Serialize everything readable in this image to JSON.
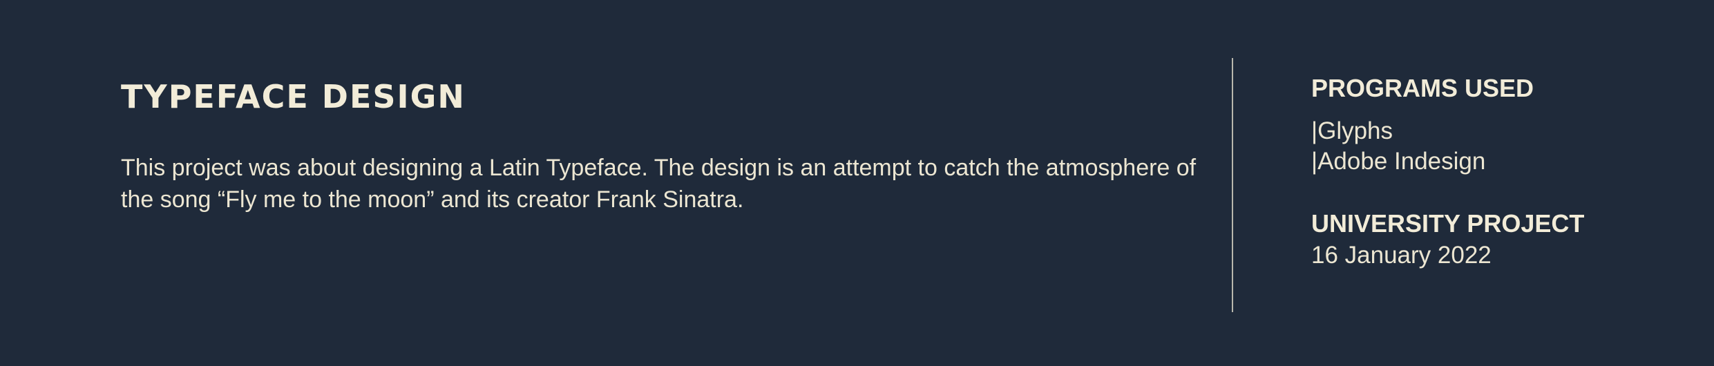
{
  "title": "TYPEFACE DESIGN",
  "description": "This project was about designing a Latin Typeface. The design is an attempt to catch the atmosphere of the song “Fly me to the moon” and its creator Frank Sinatra.",
  "programs": {
    "heading": "PROGRAMS USED",
    "items": [
      "|Glyphs",
      "|Adobe Indesign"
    ]
  },
  "project": {
    "heading": "UNIVERSITY PROJECT",
    "date": "16 January 2022"
  },
  "colors": {
    "background": "#1f2a3a",
    "text": "#f2ecd8",
    "divider": "#b9b7ad"
  }
}
